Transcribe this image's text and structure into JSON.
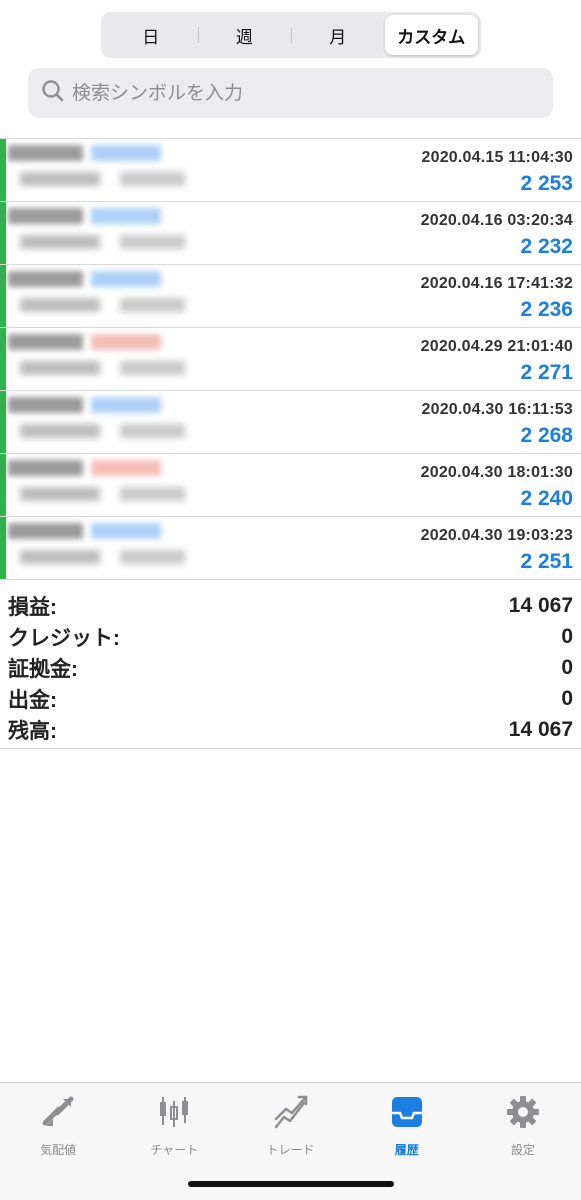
{
  "period_tabs": [
    "日",
    "週",
    "月",
    "カスタム"
  ],
  "period_active": "カスタム",
  "search": {
    "placeholder": "検索シンボルを入力"
  },
  "history": [
    {
      "time": "2020.04.15 11:04:30",
      "amount": "2 253",
      "tag_color": "#8bbcf5"
    },
    {
      "time": "2020.04.16 03:20:34",
      "amount": "2 232",
      "tag_color": "#8bbcf5"
    },
    {
      "time": "2020.04.16 17:41:32",
      "amount": "2 236",
      "tag_color": "#8bbcf5"
    },
    {
      "time": "2020.04.29 21:01:40",
      "amount": "2 271",
      "tag_color": "#f0a39a"
    },
    {
      "time": "2020.04.30 16:11:53",
      "amount": "2 268",
      "tag_color": "#8bbcf5"
    },
    {
      "time": "2020.04.30 18:01:30",
      "amount": "2 240",
      "tag_color": "#f0a39a"
    },
    {
      "time": "2020.04.30 19:03:23",
      "amount": "2 251",
      "tag_color": "#8bbcf5"
    }
  ],
  "summary": [
    {
      "label": "損益:",
      "value": "14 067"
    },
    {
      "label": "クレジット:",
      "value": "0"
    },
    {
      "label": "証拠金:",
      "value": "0"
    },
    {
      "label": "出金:",
      "value": "0"
    },
    {
      "label": "残高:",
      "value": "14 067"
    }
  ],
  "tabbar": [
    {
      "label": "気配値",
      "icon": "quotes-icon"
    },
    {
      "label": "チャート",
      "icon": "chart-icon"
    },
    {
      "label": "トレード",
      "icon": "trade-icon"
    },
    {
      "label": "履歴",
      "icon": "history-icon"
    },
    {
      "label": "設定",
      "icon": "settings-icon"
    }
  ],
  "tab_active": "履歴",
  "colors": {
    "accent": "#1a7fe0",
    "amount": "#1a7fe0",
    "row_accent": "#2fb34a",
    "inactive_icon": "#8e8e93"
  }
}
